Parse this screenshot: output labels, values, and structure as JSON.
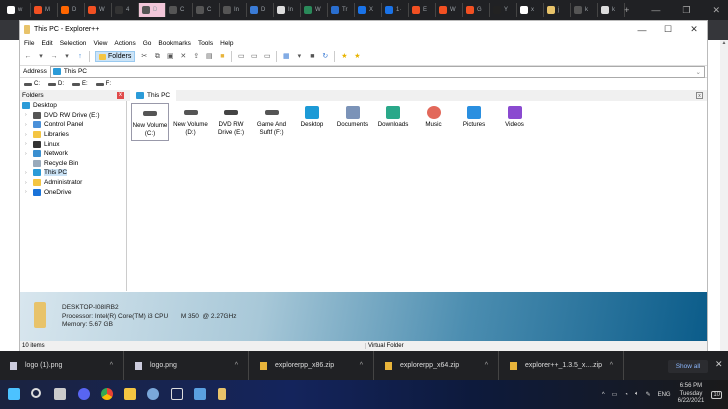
{
  "browser": {
    "tabs": [
      "w",
      "M",
      "D",
      "W",
      "4",
      "D",
      "C",
      "C",
      "In",
      "D",
      "In",
      "W",
      "Tr",
      "X",
      "1·",
      "E",
      "W",
      "G",
      "Y",
      "x",
      "j",
      "k",
      "k"
    ],
    "new_tab": "+",
    "page_scroll_up": "▲"
  },
  "window": {
    "title": "This PC - Explorer++",
    "controls": {
      "minimize": "—",
      "maximize": "☐",
      "close": "✕"
    }
  },
  "menu": [
    "File",
    "Edit",
    "Selection",
    "View",
    "Actions",
    "Go",
    "Bookmarks",
    "Tools",
    "Help"
  ],
  "toolbar": {
    "folders_label": "Folders"
  },
  "address": {
    "label": "Address",
    "value": "This PC"
  },
  "drives": [
    "C:",
    "D:",
    "E:",
    "F:"
  ],
  "folders_panel": {
    "title": "Folders",
    "close": "x"
  },
  "tab": {
    "label": "This PC",
    "close": "x"
  },
  "tree": [
    {
      "label": "Desktop",
      "level": 0,
      "color": "#2b9bd8"
    },
    {
      "label": "DVD RW Drive (E:)",
      "level": 1,
      "color": "#555"
    },
    {
      "label": "Control Panel",
      "level": 1,
      "color": "#4a90d9"
    },
    {
      "label": "Libraries",
      "level": 1,
      "color": "#f4c542"
    },
    {
      "label": "Linux",
      "level": 1,
      "color": "#333"
    },
    {
      "label": "Network",
      "level": 1,
      "color": "#3a8fd0"
    },
    {
      "label": "Recycle Bin",
      "level": 1,
      "color": "#9ab"
    },
    {
      "label": "This PC",
      "level": 1,
      "color": "#2b9bd8",
      "selected": true
    },
    {
      "label": "Administrator",
      "level": 1,
      "color": "#f4c542"
    },
    {
      "label": "OneDrive",
      "level": 1,
      "color": "#1a73d9"
    }
  ],
  "items": [
    {
      "label": "New Volume (C:)",
      "color": "#555"
    },
    {
      "label": "New Volume (D:)",
      "color": "#555"
    },
    {
      "label": "DVD RW Drive (E:)",
      "color": "#444"
    },
    {
      "label": "Game And Suftf (F:)",
      "color": "#555"
    },
    {
      "label": "Desktop",
      "color": "#1d9ad6"
    },
    {
      "label": "Documents",
      "color": "#7b93b8"
    },
    {
      "label": "Downloads",
      "color": "#2aa889"
    },
    {
      "label": "Music",
      "color": "#e2685a"
    },
    {
      "label": "Pictures",
      "color": "#2a8fe0"
    },
    {
      "label": "Videos",
      "color": "#8a4ad0"
    }
  ],
  "info": {
    "computer": "DESKTOP-I08IRB2",
    "processor": "Processor: Intel(R) Core(TM) i3 CPU       M 350  @ 2.27GHz",
    "memory": "Memory: 5.67 GB"
  },
  "status": {
    "items": "10 items",
    "location": "Virtual Folder"
  },
  "downloads": {
    "files": [
      "logo (1).png",
      "logo.png",
      "explorerpp_x86.zip",
      "explorerpp_x64.zip",
      "explorer++_1.3.5_x....zip"
    ],
    "show_all": "Show all",
    "close": "✕"
  },
  "tray": {
    "lang": "ENG",
    "time": "6:56 PM",
    "day": "Tuesday",
    "date": "6/22/2021",
    "notifications": "10"
  }
}
